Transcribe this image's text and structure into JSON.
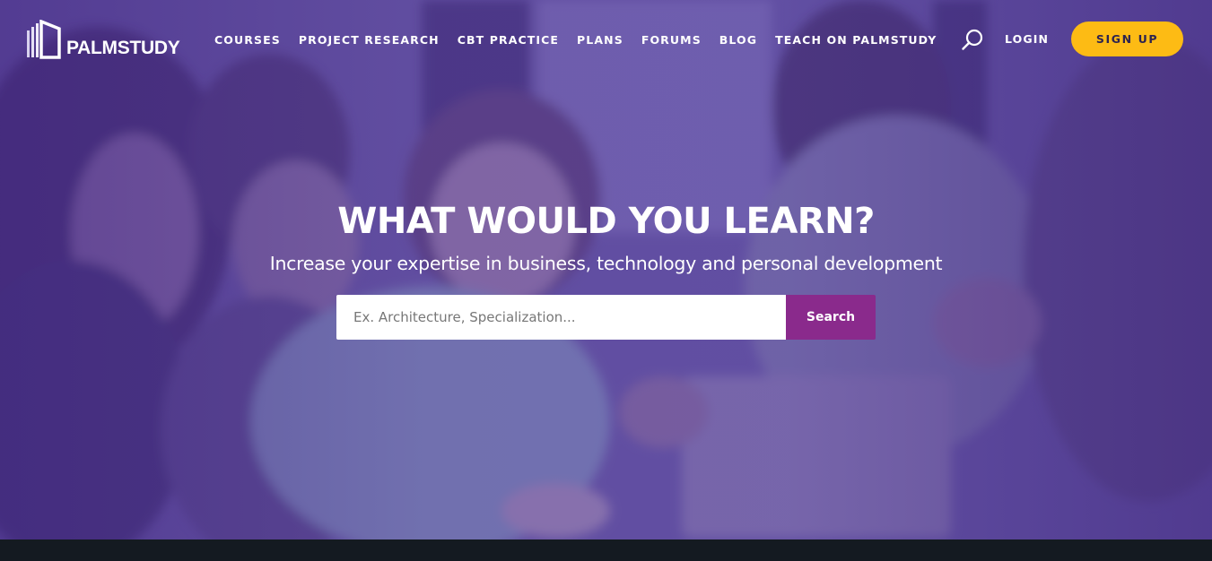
{
  "brand": {
    "name": "PALMSTUDY"
  },
  "nav": {
    "links": [
      "COURSES",
      "PROJECT RESEARCH",
      "CBT PRACTICE",
      "PLANS",
      "FORUMS",
      "BLOG",
      "TEACH ON PALMSTUDY"
    ],
    "search_icon": "search-icon",
    "login_label": "LOGIN",
    "signup_label": "SIGN UP"
  },
  "hero": {
    "headline": "WHAT WOULD YOU LEARN?",
    "subline": "Increase your expertise in business, technology and personal development",
    "search": {
      "placeholder": "Ex. Architecture, Specialization...",
      "value": "",
      "button_label": "Search"
    }
  },
  "colors": {
    "overlay": "#5a3f9a",
    "accent_yellow": "#fdbb14",
    "search_button": "#8a2a8c",
    "footer": "#141a21"
  }
}
